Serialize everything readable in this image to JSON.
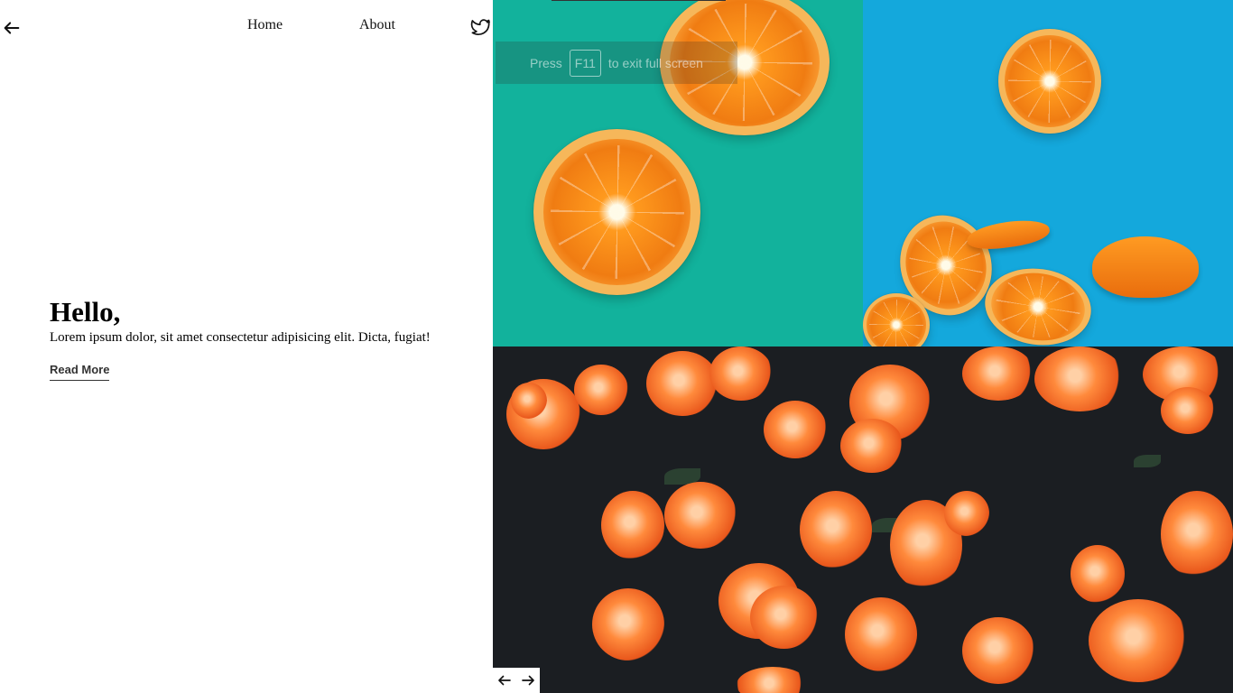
{
  "nav": {
    "home_label": "Home",
    "about_label": "About"
  },
  "hero": {
    "title": "Hello,",
    "body": "Lorem ipsum dolor, sit amet consectetur adipisicing elit. Dicta, fugiat!",
    "read_more_label": "Read More"
  },
  "fullscreen_toast": {
    "press": "Press",
    "key": "F11",
    "message": "to exit full screen"
  },
  "icons": {
    "back": "arrow-left-icon",
    "social": "twitter-icon",
    "prev": "arrow-left-icon",
    "next": "arrow-right-icon"
  },
  "colors": {
    "tile_teal": "#12b29c",
    "tile_blue": "#14a8dc",
    "tile_dark": "#1b1e22",
    "accent_orange": "#f07c12"
  }
}
